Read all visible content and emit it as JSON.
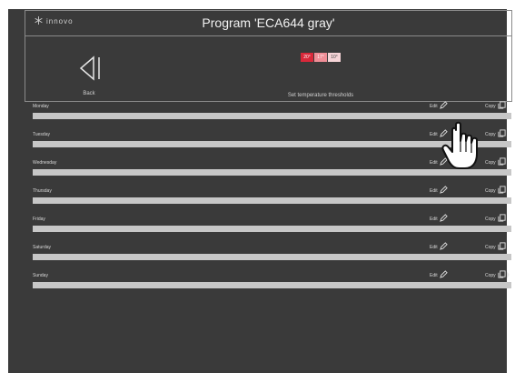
{
  "app": {
    "logo_text": "innovo",
    "title": "Program 'ECA644 gray'"
  },
  "toolbar": {
    "back_label": "Back",
    "thresholds_label": "Set temperature thresholds",
    "thresholds": [
      {
        "value": "20°",
        "color": "#d9283a"
      },
      {
        "value": "17°",
        "color": "#ef8d96"
      },
      {
        "value": "10°",
        "color": "#f6d4d7"
      }
    ]
  },
  "days": [
    {
      "name": "Monday",
      "edit": "Edit",
      "copy": "Copy"
    },
    {
      "name": "Tuesday",
      "edit": "Edit",
      "copy": "Copy"
    },
    {
      "name": "Wednesday",
      "edit": "Edit",
      "copy": "Copy"
    },
    {
      "name": "Thursday",
      "edit": "Edit",
      "copy": "Copy"
    },
    {
      "name": "Friday",
      "edit": "Edit",
      "copy": "Copy"
    },
    {
      "name": "Saturday",
      "edit": "Edit",
      "copy": "Copy"
    },
    {
      "name": "Sunday",
      "edit": "Edit",
      "copy": "Copy"
    }
  ],
  "icons": {
    "logo": "snowflake-icon",
    "back": "back-arrow-icon",
    "edit": "pencil-icon",
    "copy": "copy-icon",
    "cursor": "hand-pointer-icon"
  }
}
